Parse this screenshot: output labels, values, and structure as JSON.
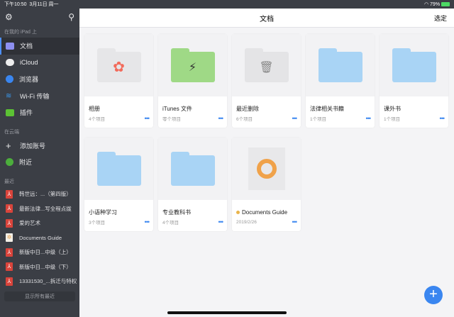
{
  "status": {
    "time": "下午10:50",
    "date": "3月11日 周一",
    "battery": "79%"
  },
  "sidebar": {
    "section_ipad": "在我的 iPad 上",
    "items": [
      {
        "label": "文档"
      },
      {
        "label": "iCloud"
      },
      {
        "label": "浏览器"
      },
      {
        "label": "Wi-Fi 传输"
      },
      {
        "label": "插件"
      }
    ],
    "section_cloud": "在云端",
    "cloud_items": [
      {
        "label": "添加账号"
      },
      {
        "label": "附近"
      }
    ],
    "section_recent": "最近",
    "recent": [
      {
        "label": "韩世远：...（第四版）"
      },
      {
        "label": "最新法律...写全程点拨"
      },
      {
        "label": "爱的艺术"
      },
      {
        "label": "Documents Guide"
      },
      {
        "label": "新版中日...中级（上）"
      },
      {
        "label": "新版中日...中级（下）"
      },
      {
        "label": "13331530_...拆迁与特权"
      }
    ],
    "show_all": "显示所有最近"
  },
  "header": {
    "title": "文档",
    "select": "选定"
  },
  "files": [
    {
      "name": "相册",
      "meta": "4个项目"
    },
    {
      "name": "iTunes 文件",
      "meta": "零个项目"
    },
    {
      "name": "最近删除",
      "meta": "6个项目"
    },
    {
      "name": "法律相关书籍",
      "meta": "1个项目"
    },
    {
      "name": "课外书",
      "meta": "1个项目"
    },
    {
      "name": "小语种学习",
      "meta": "3个项目"
    },
    {
      "name": "专业教科书",
      "meta": "4个项目"
    },
    {
      "name": "Documents Guide",
      "meta": "2019/2/26"
    }
  ],
  "colors": {
    "accent": "#3a86f0",
    "sidebar": "#3b3e45",
    "folder": "#a9d4f5"
  }
}
